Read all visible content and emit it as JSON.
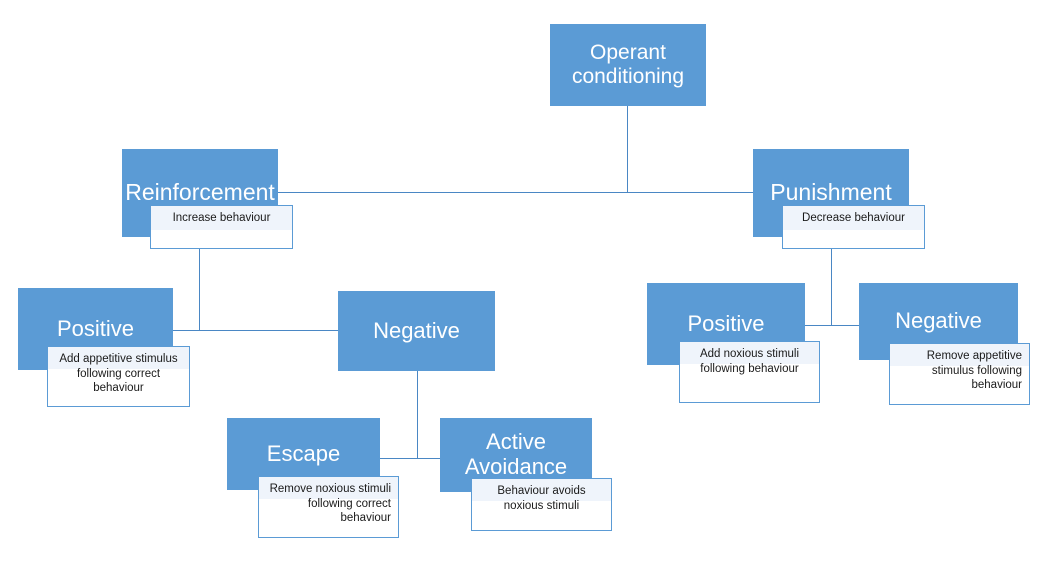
{
  "diagram": {
    "title": "Operant conditioning",
    "colors": {
      "node_fill": "#5B9BD5",
      "node_text": "#FFFFFF",
      "callout_border": "#5B9BD5",
      "callout_fill": "#FFFFFF",
      "callout_shade": "#EFF4FB",
      "connector": "#4A87C4",
      "background": "#FFFFFF"
    },
    "nodes": {
      "root": {
        "label": "Operant conditioning"
      },
      "reinforcement": {
        "label": "Reinforcement",
        "note": "Increase behaviour"
      },
      "punishment": {
        "label": "Punishment",
        "note": "Decrease behaviour"
      },
      "reinforcement_positive": {
        "label": "Positive",
        "note": "Add appetitive stimulus\nfollowing correct\nbehaviour"
      },
      "reinforcement_negative": {
        "label": "Negative",
        "note": ""
      },
      "punishment_positive": {
        "label": "Positive",
        "note": "Add noxious stimuli\nfollowing behaviour"
      },
      "punishment_negative": {
        "label": "Negative",
        "note": "Remove appetitive\nstimulus following\nbehaviour"
      },
      "escape": {
        "label": "Escape",
        "note": "Remove noxious stimuli\nfollowing correct\nbehaviour"
      },
      "active_avoidance": {
        "label": "Active Avoidance",
        "note": "Behaviour avoids\nnoxious stimuli"
      }
    }
  },
  "chart_data": {
    "type": "diagram",
    "title": "Operant conditioning",
    "layout": "hierarchical-tree",
    "levels": 4,
    "tree": [
      {
        "id": "root",
        "label": "Operant conditioning",
        "description": "",
        "children": [
          {
            "id": "reinforcement",
            "label": "Reinforcement",
            "description": "Increase behaviour",
            "children": [
              {
                "id": "reinforcement_positive",
                "label": "Positive",
                "description": "Add appetitive stimulus following correct behaviour",
                "children": []
              },
              {
                "id": "reinforcement_negative",
                "label": "Negative",
                "description": "",
                "children": [
                  {
                    "id": "escape",
                    "label": "Escape",
                    "description": "Remove noxious stimuli following correct behaviour",
                    "children": []
                  },
                  {
                    "id": "active_avoidance",
                    "label": "Active Avoidance",
                    "description": "Behaviour avoids noxious stimuli",
                    "children": []
                  }
                ]
              }
            ]
          },
          {
            "id": "punishment",
            "label": "Punishment",
            "description": "Decrease behaviour",
            "children": [
              {
                "id": "punishment_positive",
                "label": "Positive",
                "description": "Add noxious stimuli following behaviour",
                "children": []
              },
              {
                "id": "punishment_negative",
                "label": "Negative",
                "description": "Remove appetitive stimulus following behaviour",
                "children": []
              }
            ]
          }
        ]
      }
    ]
  }
}
